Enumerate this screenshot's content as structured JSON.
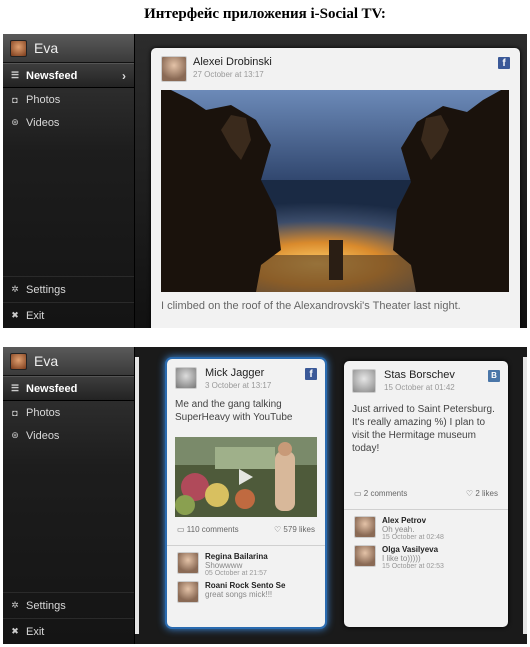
{
  "doc": {
    "title": "Интерфейс приложения i-Social TV:"
  },
  "screen1": {
    "sidebar": {
      "user_name": "Eva",
      "items": [
        {
          "label": "Newsfeed",
          "icon": "list-icon",
          "active": true
        },
        {
          "label": "Photos",
          "icon": "camera-icon"
        },
        {
          "label": "Videos",
          "icon": "film-icon"
        }
      ],
      "bottom": [
        {
          "label": "Settings",
          "icon": "gear-icon"
        },
        {
          "label": "Exit",
          "icon": "close-icon"
        }
      ]
    },
    "post": {
      "author": "Alexei Drobinski",
      "date": "27 October at 13:17",
      "network": "f",
      "text": "I climbed on the roof of the Alexandrovski's Theater last night."
    }
  },
  "screen2": {
    "sidebar": {
      "user_name": "Eva",
      "items": [
        {
          "label": "Newsfeed",
          "icon": "list-icon",
          "active": true
        },
        {
          "label": "Photos",
          "icon": "camera-icon"
        },
        {
          "label": "Videos",
          "icon": "film-icon"
        }
      ],
      "bottom": [
        {
          "label": "Settings",
          "icon": "gear-icon"
        },
        {
          "label": "Exit",
          "icon": "close-icon"
        }
      ]
    },
    "card1": {
      "author": "Mick Jagger",
      "date": "3 October at 13:17",
      "network": "f",
      "text": "Me and the gang talking SuperHeavy with YouTube",
      "comments": "110 comments",
      "likes": "579 likes",
      "comment_list": [
        {
          "name": "Regina Bailarina",
          "text": "Showwww",
          "date": "05 October at 21:57"
        },
        {
          "name": "Roani Rock Sento Se",
          "text": "great songs mick!!!",
          "date": ""
        }
      ]
    },
    "card2": {
      "author": "Stas Borschev",
      "date": "15 October at 01:42",
      "network": "B",
      "text": "Just arrived to Saint Petersburg. It's really amazing %) I plan to visit the Hermitage museum today!",
      "comments": "2 comments",
      "likes": "2 likes",
      "comment_list": [
        {
          "name": "Alex Petrov",
          "text": "Oh yeah.",
          "date": "15 October at 02:48"
        },
        {
          "name": "Olga Vasilyeva",
          "text": "I like to)))))",
          "date": "15 October at 02:53"
        }
      ]
    }
  }
}
